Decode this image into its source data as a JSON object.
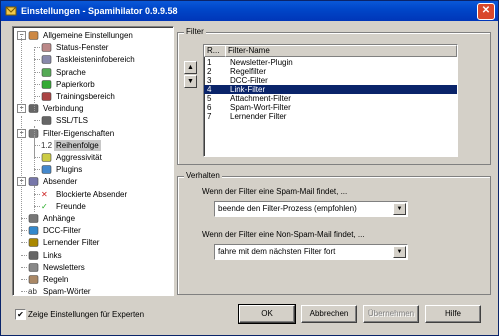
{
  "window": {
    "title": "Einstellungen - Spamihilator 0.9.9.58",
    "close_glyph": "✕"
  },
  "tree": {
    "items": [
      {
        "label": "Allgemeine Einstellungen",
        "icon": "settings-icon",
        "expander": "−"
      },
      {
        "label": "Status-Fenster",
        "icon": "window-icon"
      },
      {
        "label": "Taskleisteninfobereich",
        "icon": "taskbar-icon"
      },
      {
        "label": "Sprache",
        "icon": "language-icon"
      },
      {
        "label": "Papierkorb",
        "icon": "recycle-icon"
      },
      {
        "label": "Trainingsbereich",
        "icon": "training-icon"
      },
      {
        "label": "Verbindung",
        "icon": "connection-icon",
        "expander": "−"
      },
      {
        "label": "SSL/TLS",
        "icon": "lock-icon"
      },
      {
        "label": "Filter-Eigenschaften",
        "icon": "filter-icon",
        "expander": "−"
      },
      {
        "label": "Reihenfolge",
        "icon": "order-icon",
        "glyph": "1.2"
      },
      {
        "label": "Aggressivität",
        "icon": "aggressiveness-icon"
      },
      {
        "label": "Plugins",
        "icon": "plugins-icon"
      },
      {
        "label": "Absender",
        "icon": "sender-icon",
        "expander": "−"
      },
      {
        "label": "Blockierte Absender",
        "icon": "blocked-icon",
        "glyph": "✕"
      },
      {
        "label": "Freunde",
        "icon": "friends-icon",
        "glyph": "✓"
      },
      {
        "label": "Anhänge",
        "icon": "attachment-icon"
      },
      {
        "label": "DCC-Filter",
        "icon": "dcc-icon"
      },
      {
        "label": "Lernender Filter",
        "icon": "learning-filter-icon"
      },
      {
        "label": "Links",
        "icon": "links-icon"
      },
      {
        "label": "Newsletters",
        "icon": "newsletter-icon"
      },
      {
        "label": "Regeln",
        "icon": "rules-icon"
      },
      {
        "label": "Spam-Wörter",
        "icon": "spam-words-icon",
        "glyph": "ab"
      }
    ],
    "selected": "Reihenfolge"
  },
  "filter": {
    "group_label": "Filter",
    "columns": [
      "R...",
      "Filter-Name"
    ],
    "rows": [
      {
        "rank": "1",
        "name": "Newsletter-Plugin"
      },
      {
        "rank": "2",
        "name": "Regelfilter"
      },
      {
        "rank": "3",
        "name": "DCC-Filter"
      },
      {
        "rank": "4",
        "name": "Link-Filter"
      },
      {
        "rank": "5",
        "name": "Attachment-Filter"
      },
      {
        "rank": "6",
        "name": "Spam-Wort-Filter"
      },
      {
        "rank": "7",
        "name": "Lernender Filter"
      }
    ],
    "selected_row": "Link-Filter",
    "move_up_glyph": "▲",
    "move_down_glyph": "▼"
  },
  "verhalten": {
    "group_label": "Verhalten",
    "spam_label": "Wenn der Filter eine Spam-Mail findet, ...",
    "spam_value": "beende den Filter-Prozess (empfohlen)",
    "nonspam_label": "Wenn der Filter eine Non-Spam-Mail findet, ...",
    "nonspam_value": "fahre mit dem nächsten Filter fort",
    "drop_glyph": "▼"
  },
  "footer": {
    "expert_checkbox_label": "Zeige Einstellungen für Experten",
    "expert_checked_glyph": "✔",
    "ok_label": "OK",
    "cancel_label": "Abbrechen",
    "apply_label": "Übernehmen",
    "help_label": "Hilfe"
  },
  "colors": {
    "titlebar": "#0047c9",
    "selection": "#0a246a",
    "dialog_bg": "#d4d0c8"
  }
}
